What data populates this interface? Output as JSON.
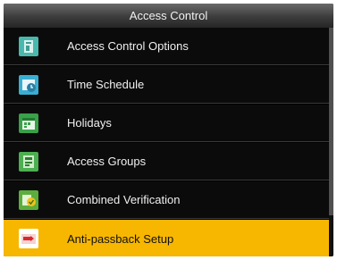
{
  "window": {
    "title": "Access Control"
  },
  "menu": {
    "items": [
      {
        "label": "Access Control Options",
        "icon": "access-options-icon",
        "selected": false
      },
      {
        "label": "Time Schedule",
        "icon": "clock-icon",
        "selected": false
      },
      {
        "label": "Holidays",
        "icon": "calendar-icon",
        "selected": false
      },
      {
        "label": "Access Groups",
        "icon": "group-icon",
        "selected": false
      },
      {
        "label": "Combined Verification",
        "icon": "verification-icon",
        "selected": false
      },
      {
        "label": "Anti-passback Setup",
        "icon": "anti-passback-icon",
        "selected": true
      }
    ]
  },
  "colors": {
    "background": "#000000",
    "highlight": "#f7b600",
    "icon_teal": "#3fb8a8",
    "icon_green": "#3aa04a"
  }
}
